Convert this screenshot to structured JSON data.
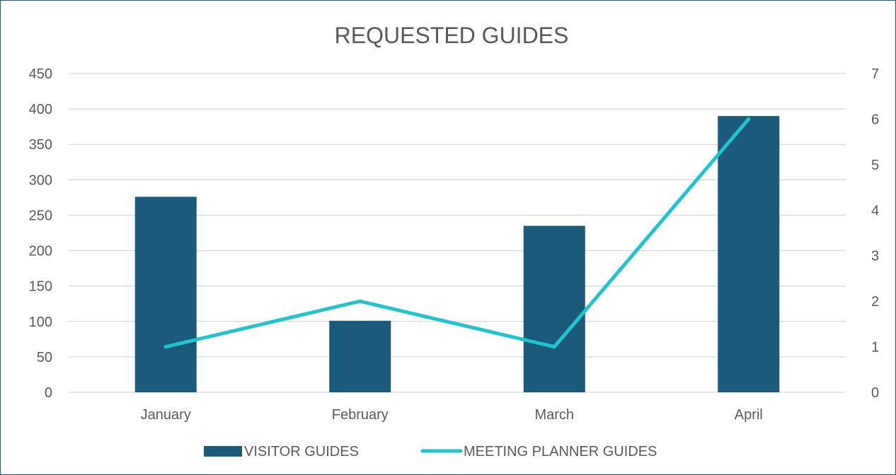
{
  "chart_data": {
    "type": "bar",
    "title": "REQUESTED GUIDES",
    "categories": [
      "January",
      "February",
      "March",
      "April"
    ],
    "series": [
      {
        "name": "VISITOR GUIDES",
        "type": "bar",
        "axis": "left",
        "values": [
          276,
          101,
          235,
          390
        ],
        "color": "#1b5a7a"
      },
      {
        "name": "MEETING PLANNER GUIDES",
        "type": "line",
        "axis": "right",
        "values": [
          1,
          2,
          1,
          6
        ],
        "color": "#1fc4cf"
      }
    ],
    "ylim": [
      0,
      450
    ],
    "y_ticks": [
      "0",
      "50",
      "100",
      "150",
      "200",
      "250",
      "300",
      "350",
      "400",
      "450"
    ],
    "y2lim": [
      0,
      7
    ],
    "y2_ticks": [
      "0",
      "1",
      "2",
      "3",
      "4",
      "5",
      "6",
      "7"
    ],
    "grid": true,
    "legend_position": "bottom",
    "xlabel": "",
    "ylabel": ""
  }
}
